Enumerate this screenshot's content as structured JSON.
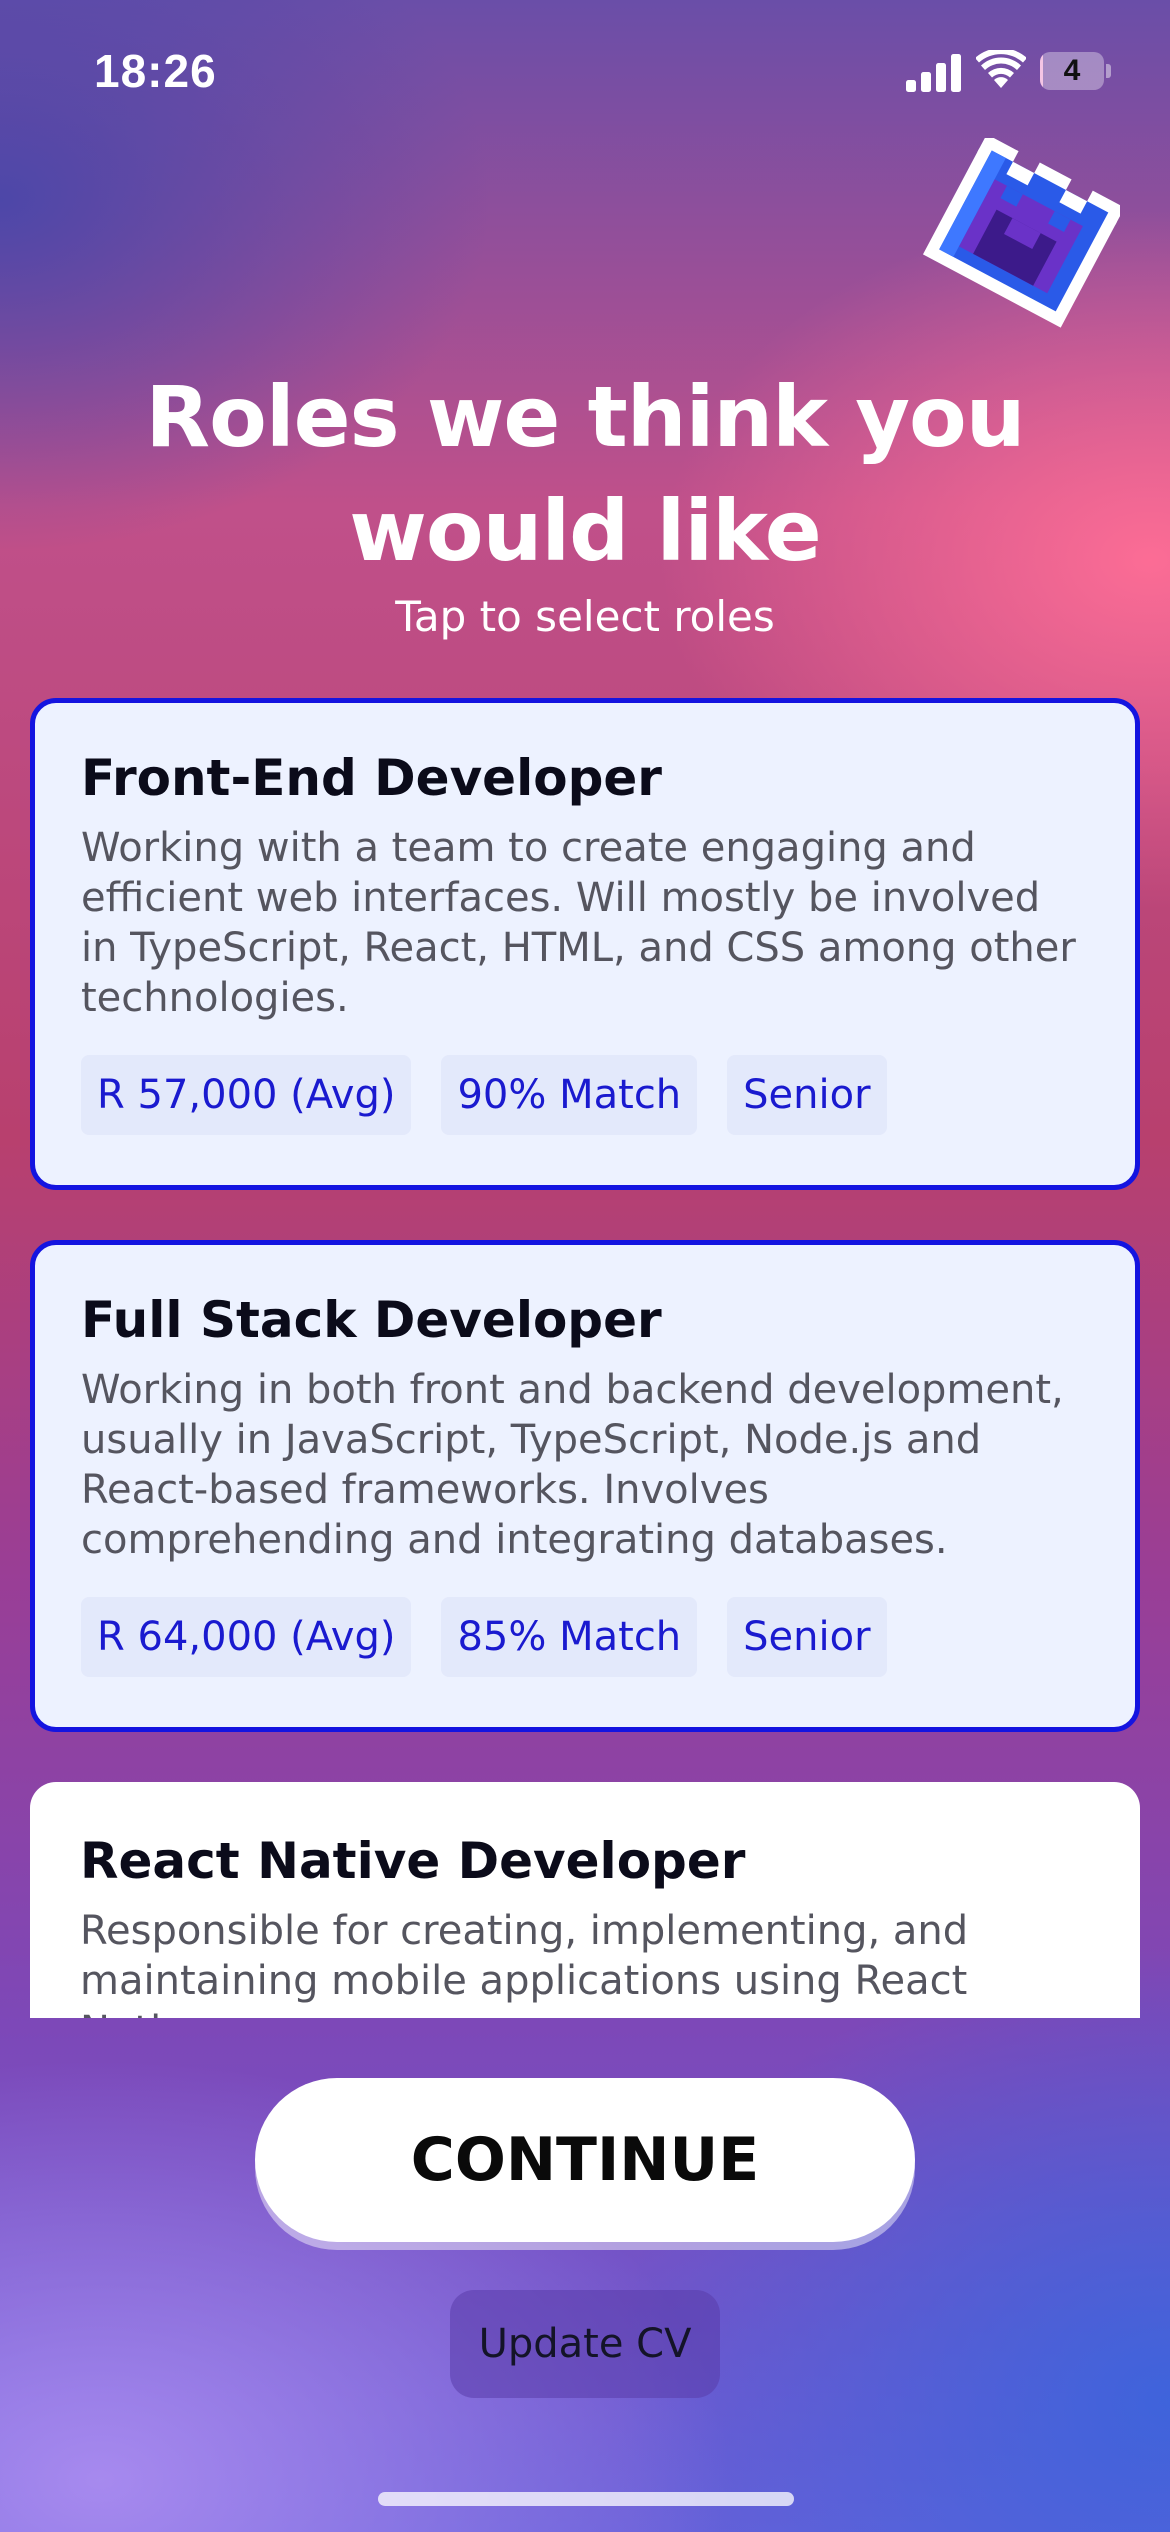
{
  "status_bar": {
    "time": "18:26",
    "battery_level": "4",
    "battery_fraction": 0.04
  },
  "header": {
    "title": "Roles we think you would like",
    "subtitle": "Tap to select roles"
  },
  "roles": [
    {
      "title": "Front-End Developer",
      "description": "Working with a team to create engaging and efficient web interfaces. Will mostly be involved in TypeScript, React, HTML, and CSS among other technologies.",
      "salary": "R 57,000 (Avg)",
      "match": "90% Match",
      "level": "Senior",
      "selected": true
    },
    {
      "title": "Full Stack Developer",
      "description": "Working in both front and backend development, usually in JavaScript, TypeScript, Node.js and React-based frameworks. Involves comprehending and integrating databases.",
      "salary": "R 64,000 (Avg)",
      "match": "85% Match",
      "level": "Senior",
      "selected": true
    },
    {
      "title": "React Native Developer",
      "description": "Responsible for creating, implementing, and maintaining mobile applications using React Native.",
      "selected": false
    }
  ],
  "actions": {
    "continue_label": "CONTINUE",
    "update_cv_label": "Update CV"
  },
  "colors": {
    "selected_border": "#1414e0",
    "selected_background": "#edf2ff",
    "tag_text": "#1a1acf",
    "tag_background": "#e3e9fb"
  },
  "icons": {
    "logo": "pixel-castle-logo",
    "signal": "cellular-signal-icon",
    "wifi": "wifi-icon",
    "battery": "battery-icon"
  }
}
